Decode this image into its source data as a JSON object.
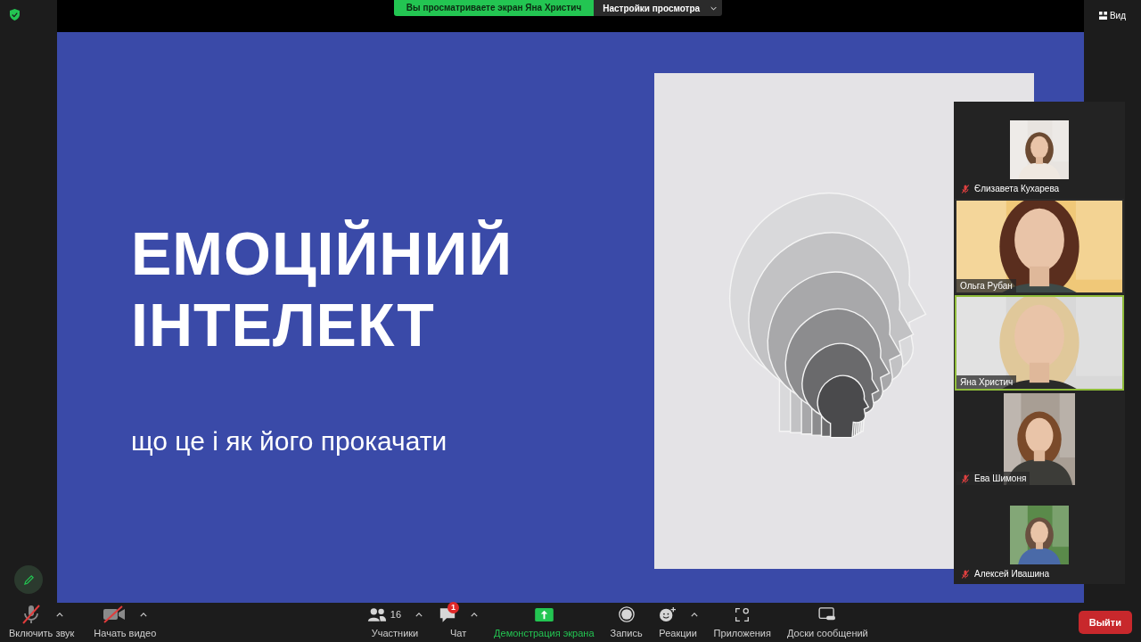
{
  "top_bar": {
    "banner": "Вы просматриваете экран Яна Христич",
    "view_options": "Настройки просмотра",
    "view": "Вид"
  },
  "slide": {
    "title_lines": [
      "ЕМОЦІЙНИЙ",
      "ІНТЕЛЕКТ"
    ],
    "subtitle": "що це і як його прокачати"
  },
  "participants": [
    {
      "name": "Єлизавета Кухарева",
      "muted": true,
      "speaking": false,
      "kind": "thumb"
    },
    {
      "name": "Ольга Рубан",
      "muted": false,
      "speaking": false,
      "kind": "full"
    },
    {
      "name": "Яна Христич",
      "muted": false,
      "speaking": true,
      "kind": "full"
    },
    {
      "name": "Ева Шимоня",
      "muted": true,
      "speaking": false,
      "kind": "portrait"
    },
    {
      "name": "Алексей Ивашина",
      "muted": true,
      "speaking": false,
      "kind": "thumb"
    }
  ],
  "toolbar_left": [
    {
      "kind": "audio",
      "label": "Включить звук",
      "off": true
    },
    {
      "kind": "video",
      "label": "Начать видео",
      "off": true
    }
  ],
  "toolbar_center": [
    {
      "kind": "participants",
      "label": "Участники",
      "count": "16",
      "menu": true
    },
    {
      "kind": "chat",
      "label": "Чат",
      "badge": "1",
      "menu": true
    },
    {
      "kind": "share",
      "label": "Демонстрация экрана",
      "menu": false
    },
    {
      "kind": "record",
      "label": "Запись",
      "menu": false
    },
    {
      "kind": "reactions",
      "label": "Реакции",
      "menu": true
    },
    {
      "kind": "apps",
      "label": "Приложения",
      "menu": false
    },
    {
      "kind": "whiteboards",
      "label": "Доски сообщений",
      "menu": false
    }
  ],
  "leave_button": "Выйти"
}
